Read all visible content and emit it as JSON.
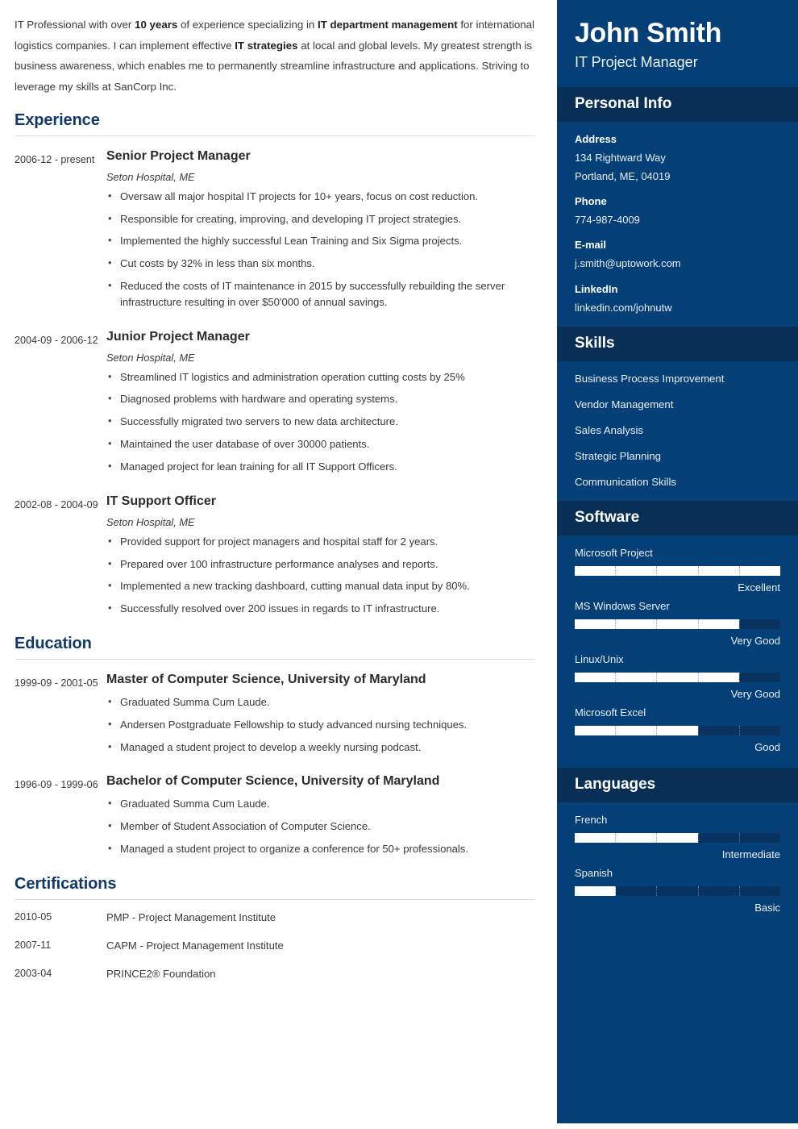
{
  "summary": {
    "parts": [
      {
        "t": "IT Professional with over ",
        "b": false
      },
      {
        "t": "10 years",
        "b": true
      },
      {
        "t": " of experience specializing in ",
        "b": false
      },
      {
        "t": "IT department management",
        "b": true
      },
      {
        "t": " for international logistics companies. I can implement effective ",
        "b": false
      },
      {
        "t": "IT strategies",
        "b": true
      },
      {
        "t": " at local and global levels. My greatest strength is business awareness, which enables me to permanently streamline infrastructure and applications. Striving to leverage my skills at SanCorp Inc.",
        "b": false
      }
    ]
  },
  "sections": {
    "experience_title": "Experience",
    "education_title": "Education",
    "certifications_title": "Certifications"
  },
  "experience": [
    {
      "date": "2006-12 - present",
      "title": "Senior Project Manager",
      "subtitle": "Seton Hospital, ME",
      "bullets": [
        "Oversaw all major hospital IT projects for 10+ years, focus on cost reduction.",
        "Responsible for creating, improving, and developing IT project strategies.",
        "Implemented the highly successful Lean Training and Six Sigma projects.",
        "Cut costs by 32% in less than six months.",
        "Reduced the costs of IT maintenance in 2015 by successfully rebuilding the server infrastructure resulting in over $50'000 of annual savings."
      ]
    },
    {
      "date": "2004-09 - 2006-12",
      "title": "Junior Project Manager",
      "subtitle": "Seton Hospital, ME",
      "bullets": [
        "Streamlined IT logistics and administration operation cutting costs by 25%",
        "Diagnosed problems with hardware and operating systems.",
        "Successfully migrated two servers to new data architecture.",
        "Maintained the user database of over 30000 patients.",
        "Managed project for lean training for all IT Support Officers."
      ]
    },
    {
      "date": "2002-08 - 2004-09",
      "title": "IT Support Officer",
      "subtitle": "Seton Hospital, ME",
      "bullets": [
        "Provided support for project managers and hospital staff for 2 years.",
        "Prepared over 100 infrastructure performance analyses and reports.",
        "Implemented a new tracking dashboard, cutting manual data input by 80%.",
        "Successfully resolved over 200 issues in regards to IT infrastructure."
      ]
    }
  ],
  "education": [
    {
      "date": "1999-09 - 2001-05",
      "title": "Master of Computer Science, University of Maryland",
      "bullets": [
        "Graduated Summa Cum Laude.",
        "Andersen Postgraduate Fellowship to study advanced nursing techniques.",
        "Managed a student project to develop a weekly nursing podcast."
      ]
    },
    {
      "date": "1996-09 - 1999-06",
      "title": "Bachelor of Computer Science, University of Maryland",
      "bullets": [
        "Graduated Summa Cum Laude.",
        "Member of Student Association of Computer Science.",
        "Managed a student project to organize a conference for 50+ professionals."
      ]
    }
  ],
  "certifications": [
    {
      "date": "2010-05",
      "name": "PMP - Project Management Institute"
    },
    {
      "date": "2007-11",
      "name": "CAPM - Project Management Institute"
    },
    {
      "date": "2003-04",
      "name": "PRINCE2® Foundation"
    }
  ],
  "sidebar": {
    "name": "John Smith",
    "role": "IT Project Manager",
    "personal_info_title": "Personal Info",
    "personal_info": [
      {
        "label": "Address",
        "values": [
          "134 Rightward Way",
          "Portland, ME, 04019"
        ]
      },
      {
        "label": "Phone",
        "values": [
          "774-987-4009"
        ]
      },
      {
        "label": "E-mail",
        "values": [
          "j.smith@uptowork.com"
        ]
      },
      {
        "label": "LinkedIn",
        "values": [
          "linkedin.com/johnutw"
        ]
      }
    ],
    "skills_title": "Skills",
    "skills": [
      "Business Process Improvement",
      "Vendor Management",
      "Sales Analysis",
      "Strategic Planning",
      "Communication Skills"
    ],
    "software_title": "Software",
    "software": [
      {
        "name": "Microsoft Project",
        "level": "Excellent",
        "percent": 100
      },
      {
        "name": "MS Windows Server",
        "level": "Very Good",
        "percent": 80
      },
      {
        "name": "Linux/Unix",
        "level": "Very Good",
        "percent": 80
      },
      {
        "name": "Microsoft Excel",
        "level": "Good",
        "percent": 60
      }
    ],
    "languages_title": "Languages",
    "languages": [
      {
        "name": "French",
        "level": "Intermediate",
        "percent": 60
      },
      {
        "name": "Spanish",
        "level": "Basic",
        "percent": 20
      }
    ]
  },
  "colors": {
    "sidebar_bg": "#044077",
    "sidebar_header_bg": "#0a2f57",
    "section_heading": "#12396b",
    "bar_fill": "#ffffff",
    "bar_track": "#0a3260"
  }
}
